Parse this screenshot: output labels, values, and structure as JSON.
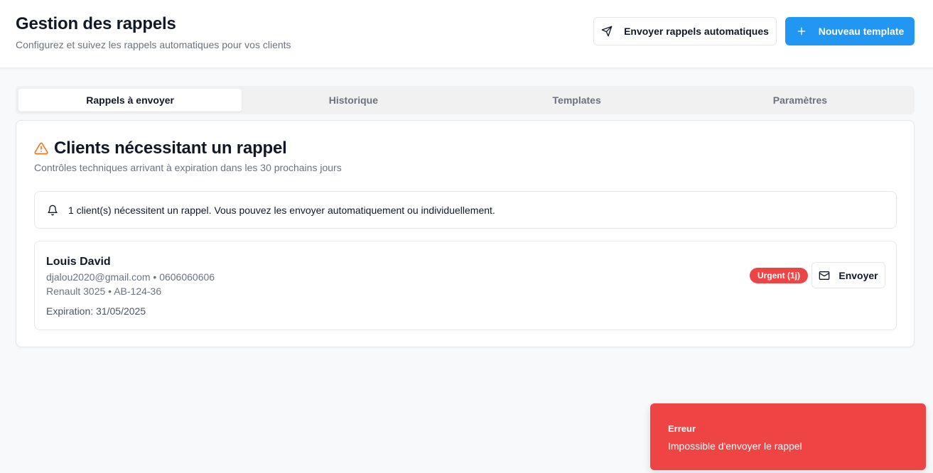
{
  "header": {
    "title": "Gestion des rappels",
    "subtitle": "Configurez et suivez les rappels automatiques pour vos clients",
    "auto_button_label": "Envoyer rappels automatiques",
    "new_button_label": "Nouveau template"
  },
  "tabs": [
    {
      "label": "Rappels à envoyer",
      "active": true
    },
    {
      "label": "Historique",
      "active": false
    },
    {
      "label": "Templates",
      "active": false
    },
    {
      "label": "Paramètres",
      "active": false
    }
  ],
  "card": {
    "title": "Clients nécessitant un rappel",
    "subtitle": "Contrôles techniques arrivant à expiration dans les 30 prochains jours",
    "title_icon": "warning-icon",
    "alert_icon": "bell-icon",
    "alert_text": "1 client(s) nécessitent un rappel. Vous pouvez les envoyer automatiquement ou individuellement."
  },
  "clients": [
    {
      "name": "Louis David",
      "contact": "djalou2020@gmail.com • 0606060606",
      "vehicle": "Renault 3025 • AB-124-36",
      "expiration": "Expiration: 31/05/2025",
      "badge": "Urgent (1j)",
      "send_label": "Envoyer"
    }
  ],
  "toast": {
    "title": "Erreur",
    "message": "Impossible d'envoyer le rappel"
  },
  "colors": {
    "primary": "#2296f3",
    "danger": "#ef4444",
    "warning": "#f97316"
  }
}
